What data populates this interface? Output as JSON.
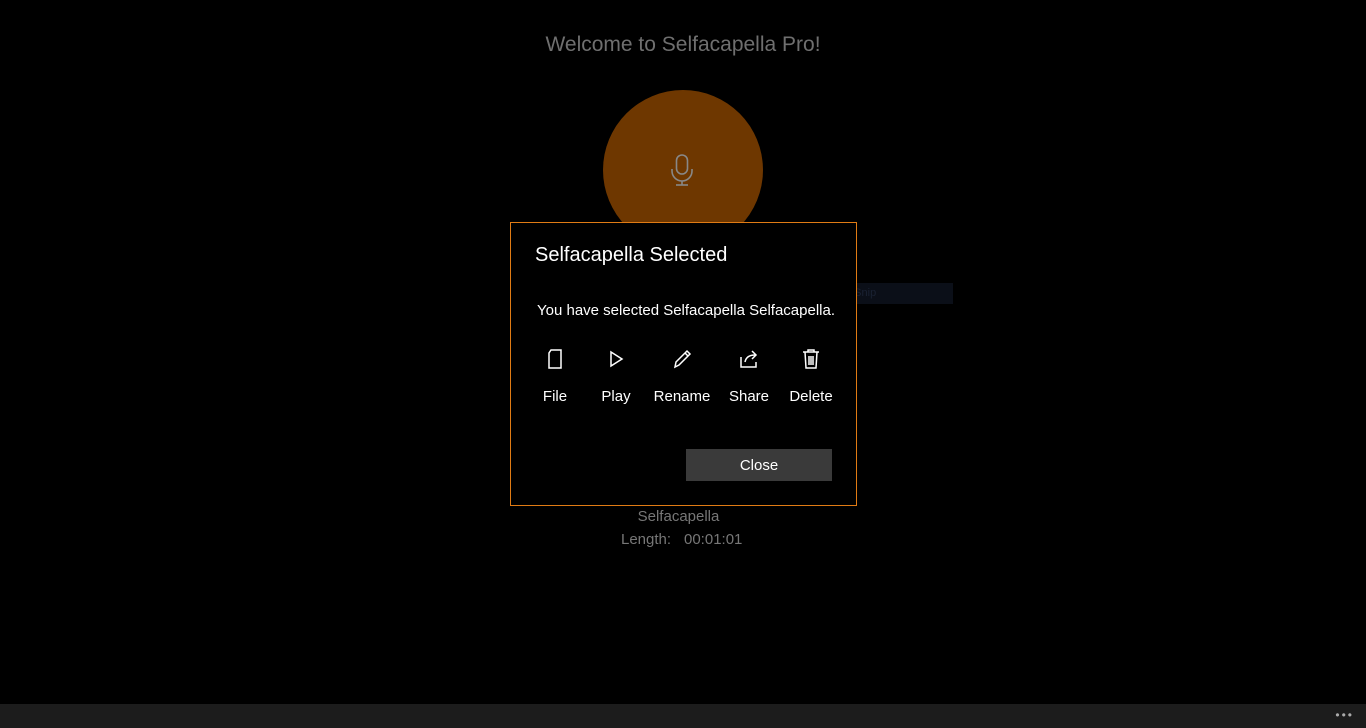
{
  "background": {
    "title": "Welcome to Selfacapella Pro!",
    "recording_name": "Selfacapella",
    "length_label": "Length:",
    "length_value": "00:01:01",
    "snip_overlay_text": "Window Snip"
  },
  "dialog": {
    "title": "Selfacapella Selected",
    "message": "You have selected Selfacapella Selfacapella.",
    "actions": [
      {
        "label": "File",
        "icon": "file-icon"
      },
      {
        "label": "Play",
        "icon": "play-icon"
      },
      {
        "label": "Rename",
        "icon": "pencil-icon"
      },
      {
        "label": "Share",
        "icon": "share-icon"
      },
      {
        "label": "Delete",
        "icon": "trash-icon"
      }
    ],
    "close_label": "Close"
  },
  "colors": {
    "accent": "#e07b14",
    "record_circle": "#6e3700"
  }
}
